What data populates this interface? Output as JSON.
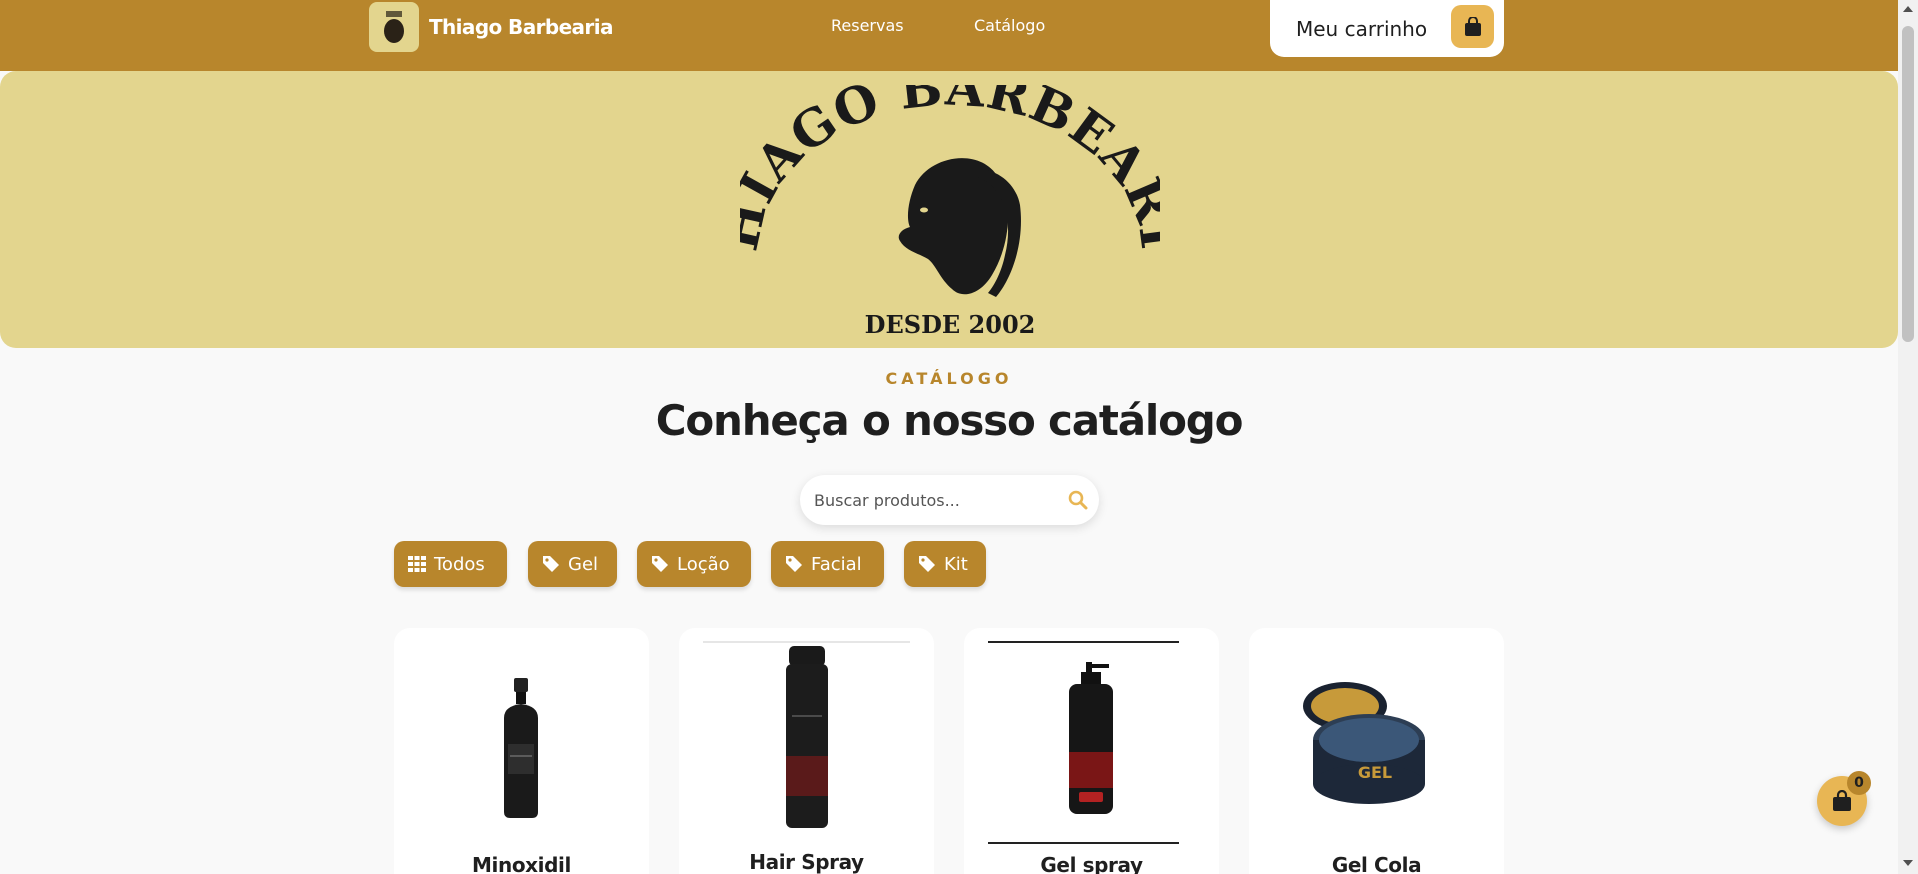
{
  "header": {
    "brand_name": "Thiago Barbearia",
    "nav": {
      "reservas": "Reservas",
      "catalogo": "Catálogo"
    },
    "cart_label": "Meu carrinho"
  },
  "hero": {
    "logo_text": "THIAGO BARBEARIA",
    "logo_subtext": "DESDE 2002"
  },
  "catalog": {
    "eyebrow": "CATÁLOGO",
    "title": "Conheça o nosso catálogo"
  },
  "search": {
    "placeholder": "Buscar produtos..."
  },
  "filters": [
    {
      "label": "Todos",
      "icon": "grid-icon"
    },
    {
      "label": "Gel",
      "icon": "tag-icon"
    },
    {
      "label": "Loção",
      "icon": "tag-icon"
    },
    {
      "label": "Facial",
      "icon": "tag-icon"
    },
    {
      "label": "Kit",
      "icon": "tag-icon"
    }
  ],
  "products": [
    {
      "name": "Minoxidil"
    },
    {
      "name": "Hair Spray"
    },
    {
      "name": "Gel spray"
    },
    {
      "name": "Gel Cola"
    }
  ],
  "floating_cart": {
    "count": "0"
  },
  "colors": {
    "primary": "#b8862c",
    "accent": "#e8b654",
    "hero_bg": "#e3d58e",
    "page_bg": "#f9f9f9"
  }
}
